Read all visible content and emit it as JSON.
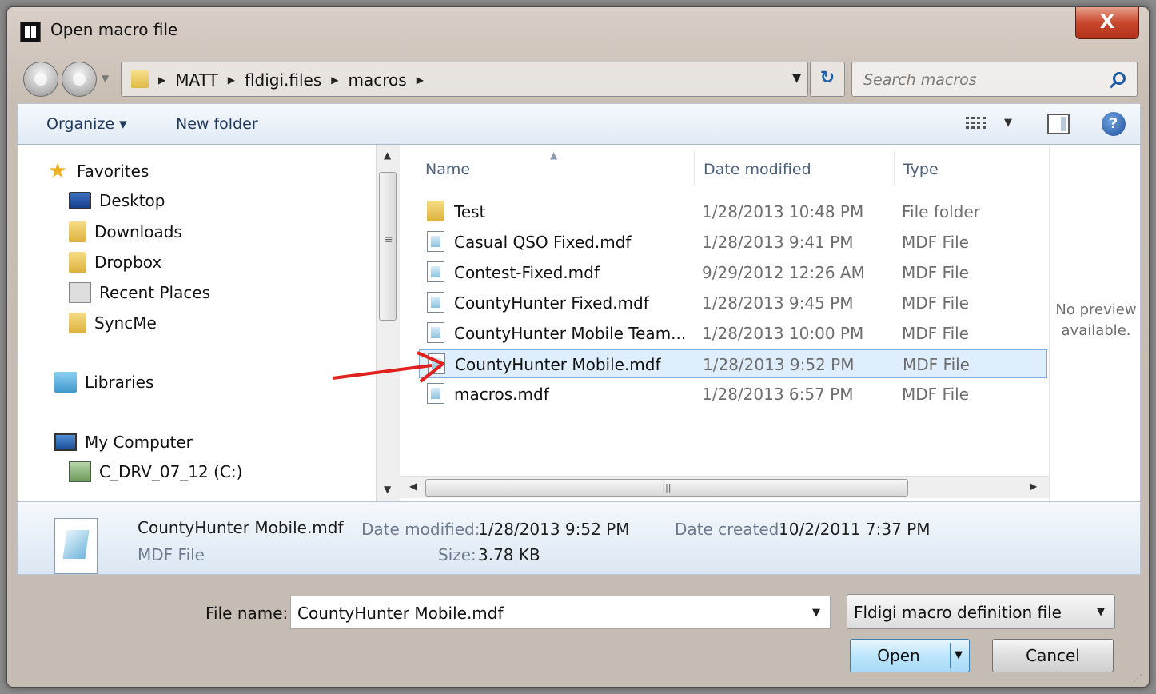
{
  "window": {
    "title": "Open macro file",
    "close_glyph": "X"
  },
  "nav": {
    "breadcrumbs": [
      "MATT",
      "fldigi.files",
      "macros"
    ],
    "search_placeholder": "Search macros"
  },
  "toolbar": {
    "organize": "Organize",
    "new_folder": "New folder"
  },
  "navpane": {
    "favorites": "Favorites",
    "favorite_items": [
      "Desktop",
      "Downloads",
      "Dropbox",
      "Recent Places",
      "SyncMe"
    ],
    "libraries": "Libraries",
    "computer": "My Computer",
    "drive": "C_DRV_07_12 (C:)"
  },
  "file_list": {
    "columns": {
      "name": "Name",
      "date": "Date modified",
      "type": "Type"
    },
    "rows": [
      {
        "name": "Test",
        "date": "1/28/2013 10:48 PM",
        "type": "File folder",
        "icon": "folder-icon"
      },
      {
        "name": "Casual QSO Fixed.mdf",
        "date": "1/28/2013 9:41 PM",
        "type": "MDF File",
        "icon": "file-icon"
      },
      {
        "name": "Contest-Fixed.mdf",
        "date": "9/29/2012 12:26 AM",
        "type": "MDF File",
        "icon": "file-icon"
      },
      {
        "name": "CountyHunter Fixed.mdf",
        "date": "1/28/2013 9:45 PM",
        "type": "MDF File",
        "icon": "file-icon"
      },
      {
        "name": "CountyHunter Mobile Team...",
        "date": "1/28/2013 10:00 PM",
        "type": "MDF File",
        "icon": "file-icon"
      },
      {
        "name": "CountyHunter Mobile.mdf",
        "date": "1/28/2013 9:52 PM",
        "type": "MDF File",
        "icon": "file-icon",
        "selected": true
      },
      {
        "name": "macros.mdf",
        "date": "1/28/2013 6:57 PM",
        "type": "MDF File",
        "icon": "file-icon"
      }
    ],
    "annotation_color": "#e0201c"
  },
  "preview": {
    "line1": "No preview",
    "line2": "available."
  },
  "details": {
    "filename": "CountyHunter Mobile.mdf",
    "filetype": "MDF File",
    "date_modified_label": "Date modified:",
    "date_modified": "1/28/2013 9:52 PM",
    "date_created_label": "Date created:",
    "date_created": "10/2/2011 7:37 PM",
    "size_label": "Size:",
    "size": "3.78 KB"
  },
  "footer": {
    "file_name_label": "File name:",
    "file_name_value": "CountyHunter Mobile.mdf",
    "file_type_value": "Fldigi macro definition file",
    "open_label": "Open",
    "cancel_label": "Cancel"
  }
}
